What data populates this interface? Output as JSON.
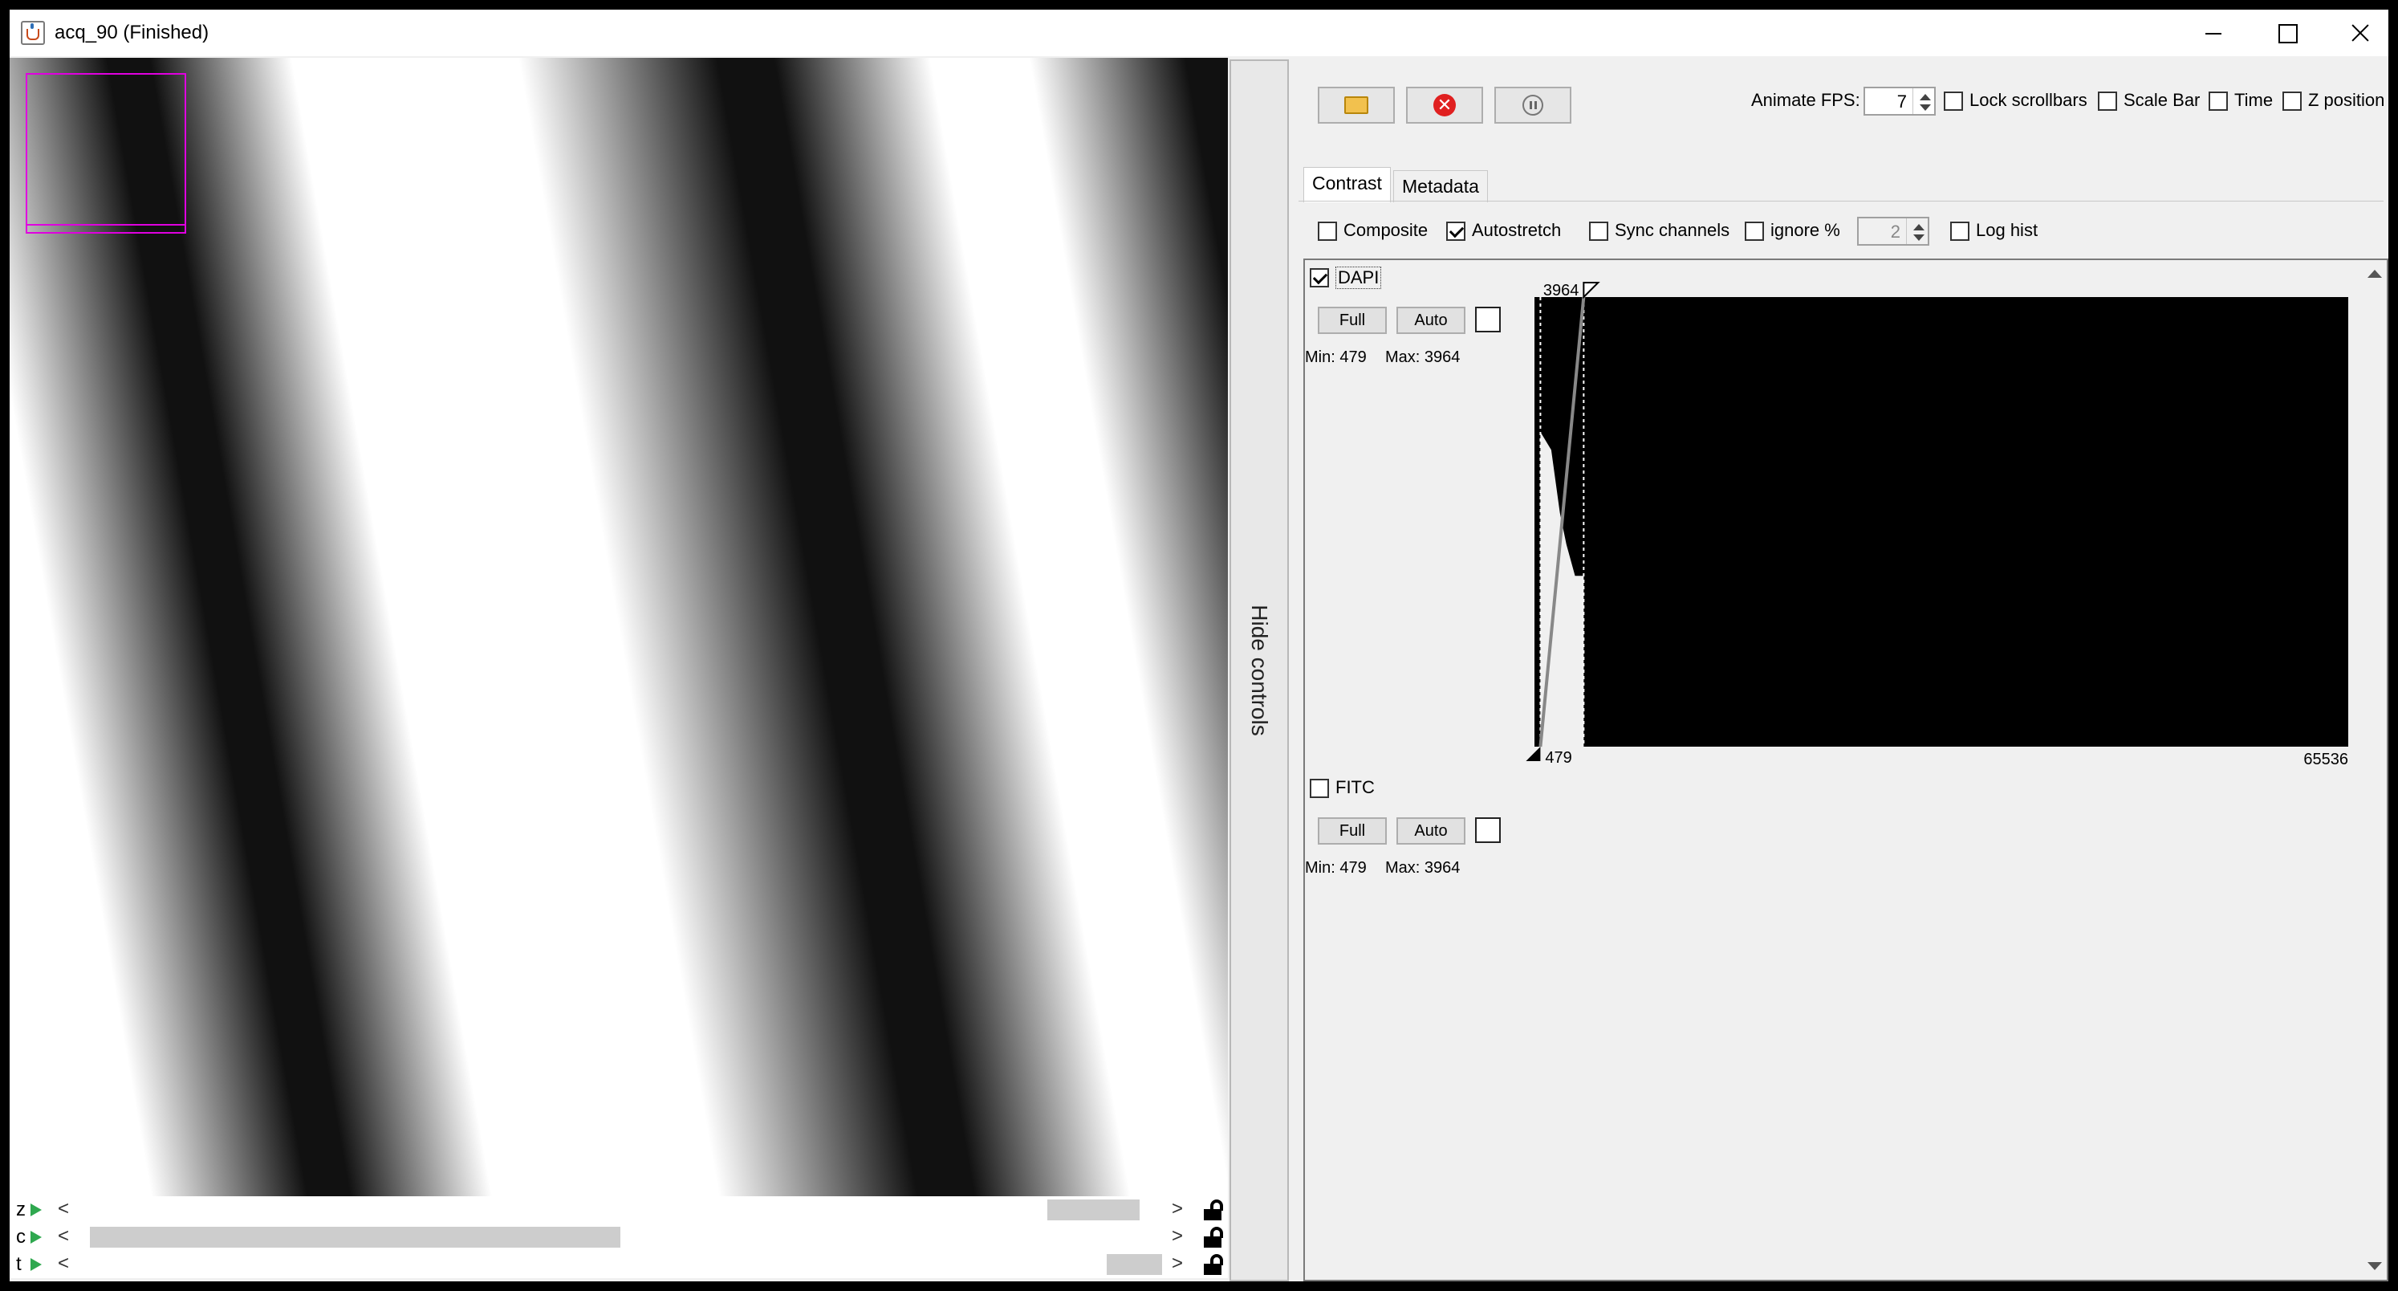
{
  "window": {
    "title": "acq_90 (Finished)"
  },
  "toolbar": {
    "animate_fps_label": "Animate FPS:",
    "animate_fps_value": "7",
    "lock_scrollbars_label": "Lock scrollbars",
    "scale_bar_label": "Scale Bar",
    "time_label": "Time",
    "z_position_label": "Z position",
    "icons": [
      "folder-icon",
      "stop-icon",
      "pause-icon"
    ]
  },
  "tabs": [
    {
      "label": "Contrast",
      "active": true
    },
    {
      "label": "Metadata",
      "active": false
    }
  ],
  "contrast_options": {
    "composite_label": "Composite",
    "composite_checked": false,
    "autostretch_label": "Autostretch",
    "autostretch_checked": true,
    "sync_channels_label": "Sync channels",
    "sync_channels_checked": false,
    "ignore_label": "ignore %",
    "ignore_checked": false,
    "ignore_value": "2",
    "log_hist_label": "Log hist",
    "log_hist_checked": false
  },
  "channels": [
    {
      "name": "DAPI",
      "checked": true,
      "full_label": "Full",
      "auto_label": "Auto",
      "min_label": "Min: 479",
      "max_label": "Max: 3964",
      "color": "#ffffff"
    },
    {
      "name": "FITC",
      "checked": false,
      "full_label": "Full",
      "auto_label": "Auto",
      "min_label": "Min: 479",
      "max_label": "Max: 3964",
      "color": "#ffffff"
    }
  ],
  "histogram": {
    "top_value": "3964",
    "bottom_value": "479",
    "range_max_label": "65536",
    "min": 479,
    "max": 3964,
    "range_max": 65536
  },
  "scrollbars": [
    {
      "axis": "z",
      "thumb_start": 0.894,
      "thumb_end": 0.979
    },
    {
      "axis": "c",
      "thumb_start": 0.01,
      "thumb_end": 0.5
    },
    {
      "axis": "t",
      "thumb_start": 0.949,
      "thumb_end": 1.0
    }
  ],
  "side_panel": {
    "hide_controls_label": "Hide controls"
  },
  "colors": {
    "overlay_box": "#e000e0",
    "play_arrow": "#2fa84f",
    "stop_red": "#e02020"
  }
}
